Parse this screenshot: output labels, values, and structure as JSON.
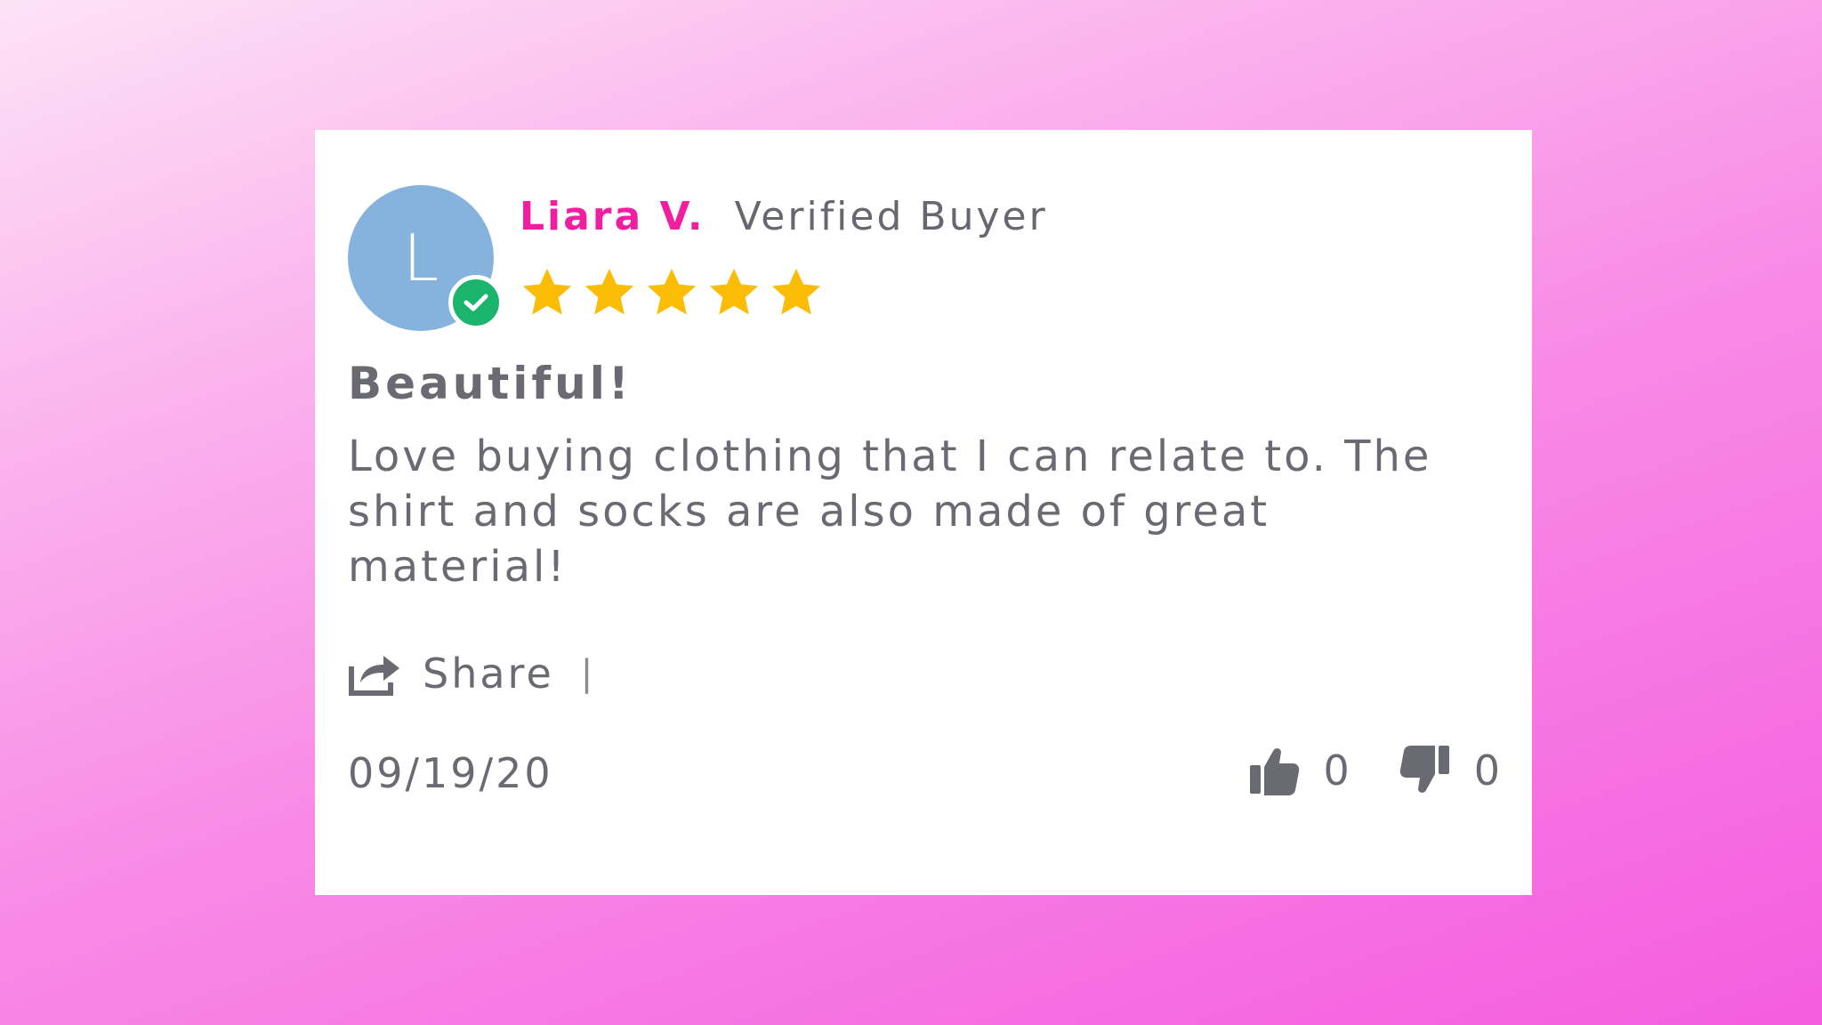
{
  "review": {
    "avatar_initial": "L",
    "reviewer_name": "Liara V.",
    "verified_label": "Verified Buyer",
    "rating": 5,
    "rating_max": 5,
    "title": "Beautiful!",
    "body": "Love buying clothing that I can relate to. The shirt and socks are also made of great material!",
    "share_label": "Share",
    "share_divider": "|",
    "date": "09/19/20",
    "thumbs_up_count": "0",
    "thumbs_down_count": "0"
  },
  "icons": {
    "verified": "check-circle-icon",
    "star": "star-icon",
    "share": "share-icon",
    "thumbs_up": "thumbs-up-icon",
    "thumbs_down": "thumbs-down-icon"
  },
  "colors": {
    "reviewer_name": "#ef1fa0",
    "star": "#fbbc05",
    "avatar": "#86b3de",
    "verified_badge": "#1bb46d",
    "text": "#6a6a72"
  }
}
